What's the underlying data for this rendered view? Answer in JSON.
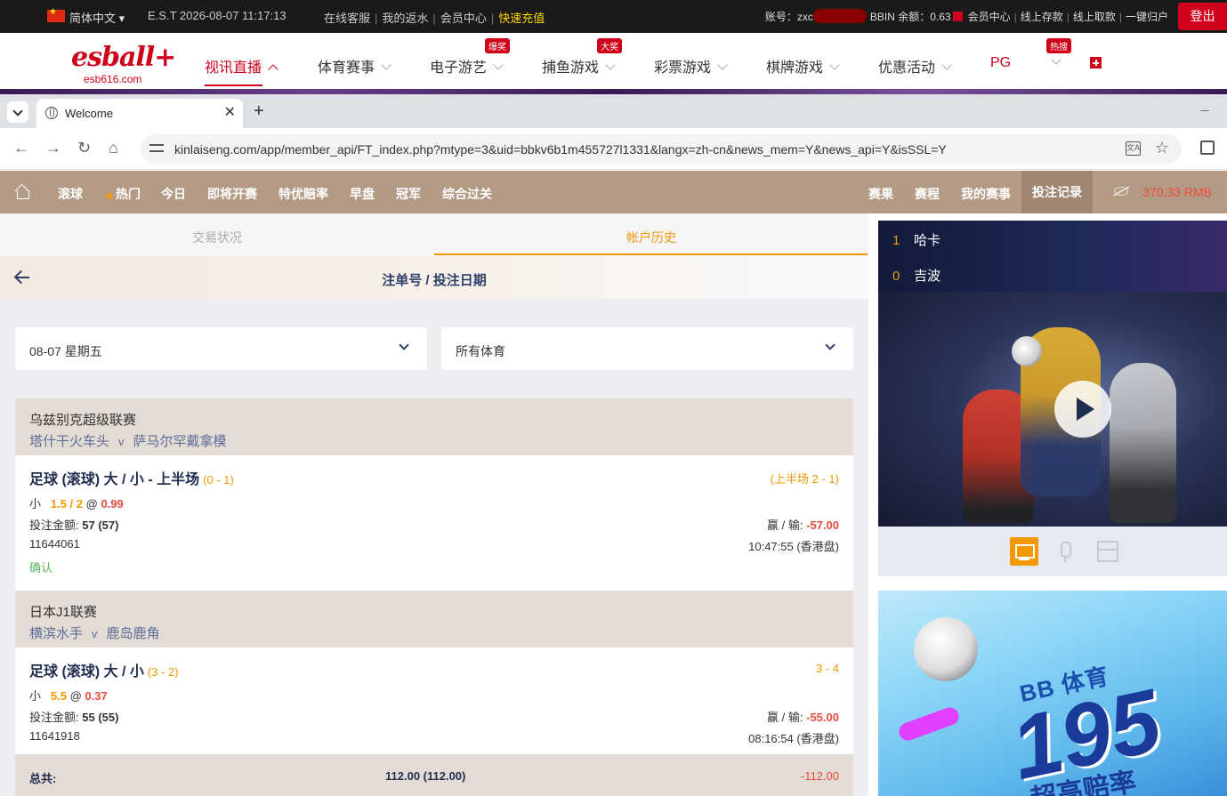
{
  "topbar": {
    "language": "简体中文 ▾",
    "clock": "E.S.T 2026-08-07 11:17:13",
    "links": [
      "在线客服",
      "我的返水",
      "会员中心"
    ],
    "quick_topup": "快速充值",
    "account_label": "账号：zxc",
    "bbin_balance": "BBIN 余额：0.63",
    "right_links": [
      "会员中心",
      "线上存款",
      "线上取款",
      "一键归户"
    ],
    "logout": "登出"
  },
  "site_nav": {
    "logo": "esball+",
    "logo_domain": "esb616.com",
    "items": [
      {
        "label": "视讯直播",
        "active": true
      },
      {
        "label": "体育赛事"
      },
      {
        "label": "电子游艺",
        "badge": "爆奖"
      },
      {
        "label": "捕鱼游戏",
        "badge": "大奖"
      },
      {
        "label": "彩票游戏"
      },
      {
        "label": "棋牌游戏"
      },
      {
        "label": "优惠活动"
      },
      {
        "label": "PG"
      },
      {
        "label": "",
        "badge": "热搜"
      }
    ]
  },
  "browser": {
    "tab_title": "Welcome",
    "tab_close": "✕",
    "new_tab": "+",
    "url": "kinlaiseng.com/app/member_api/FT_index.php?mtype=3&uid=bbkv6b1m455727l1331&langx=zh-cn&news_mem=Y&news_api=Y&isSSL=Y"
  },
  "sportsbook_nav": {
    "left": [
      "滚球",
      "热门",
      "今日",
      "即将开赛",
      "特优赔率",
      "早盘",
      "冠军",
      "综合过关"
    ],
    "right": [
      "赛果",
      "赛程",
      "我的赛事",
      "投注记录"
    ],
    "balance": "370.33  RMB"
  },
  "subtabs": [
    "交易状况",
    "帐户历史"
  ],
  "page_title": "注单号 / 投注日期",
  "filters": {
    "date": "08-07 星期五",
    "sport": "所有体育"
  },
  "bets": [
    {
      "league": "乌兹别克超级联赛",
      "home": "塔什干火车头",
      "vs": "v",
      "away": "萨马尔罕戴拿模",
      "market": "足球 (滚球) 大 / 小 - 上半场",
      "score_at_bet": "(0 - 1)",
      "result_score": "(上半场 2 - 1)",
      "selection": "小",
      "line": "1.5 / 2",
      "at": "@",
      "odds": "0.99",
      "stake_label": "投注金额:",
      "stake": "57 (57)",
      "wl_label": "赢 / 输:",
      "wl": "-57.00",
      "ticket": "11644061",
      "time": "10:47:55 (香港盘)",
      "status": "确认"
    },
    {
      "league": "日本J1联赛",
      "home": "横滨水手",
      "vs": "v",
      "away": "鹿岛鹿角",
      "market": "足球 (滚球) 大 / 小",
      "score_at_bet": "(3 - 2)",
      "result_score": "3 - 4",
      "selection": "小",
      "line": "5.5",
      "at": "@",
      "odds": "0.37",
      "stake_label": "投注金额:",
      "stake": "55 (55)",
      "wl_label": "赢 / 输:",
      "wl": "-55.00",
      "ticket": "11641918",
      "time": "08:16:54 (香港盘)"
    }
  ],
  "total": {
    "label": "总共:",
    "amount": "112.00 (112.00)",
    "wl": "-112.00"
  },
  "live_score": [
    {
      "score": "1",
      "team": "哈卡"
    },
    {
      "score": "0",
      "team": "吉波"
    }
  ],
  "promo": {
    "title": "BB 体育",
    "big": "195",
    "sub": "超高赔率"
  }
}
